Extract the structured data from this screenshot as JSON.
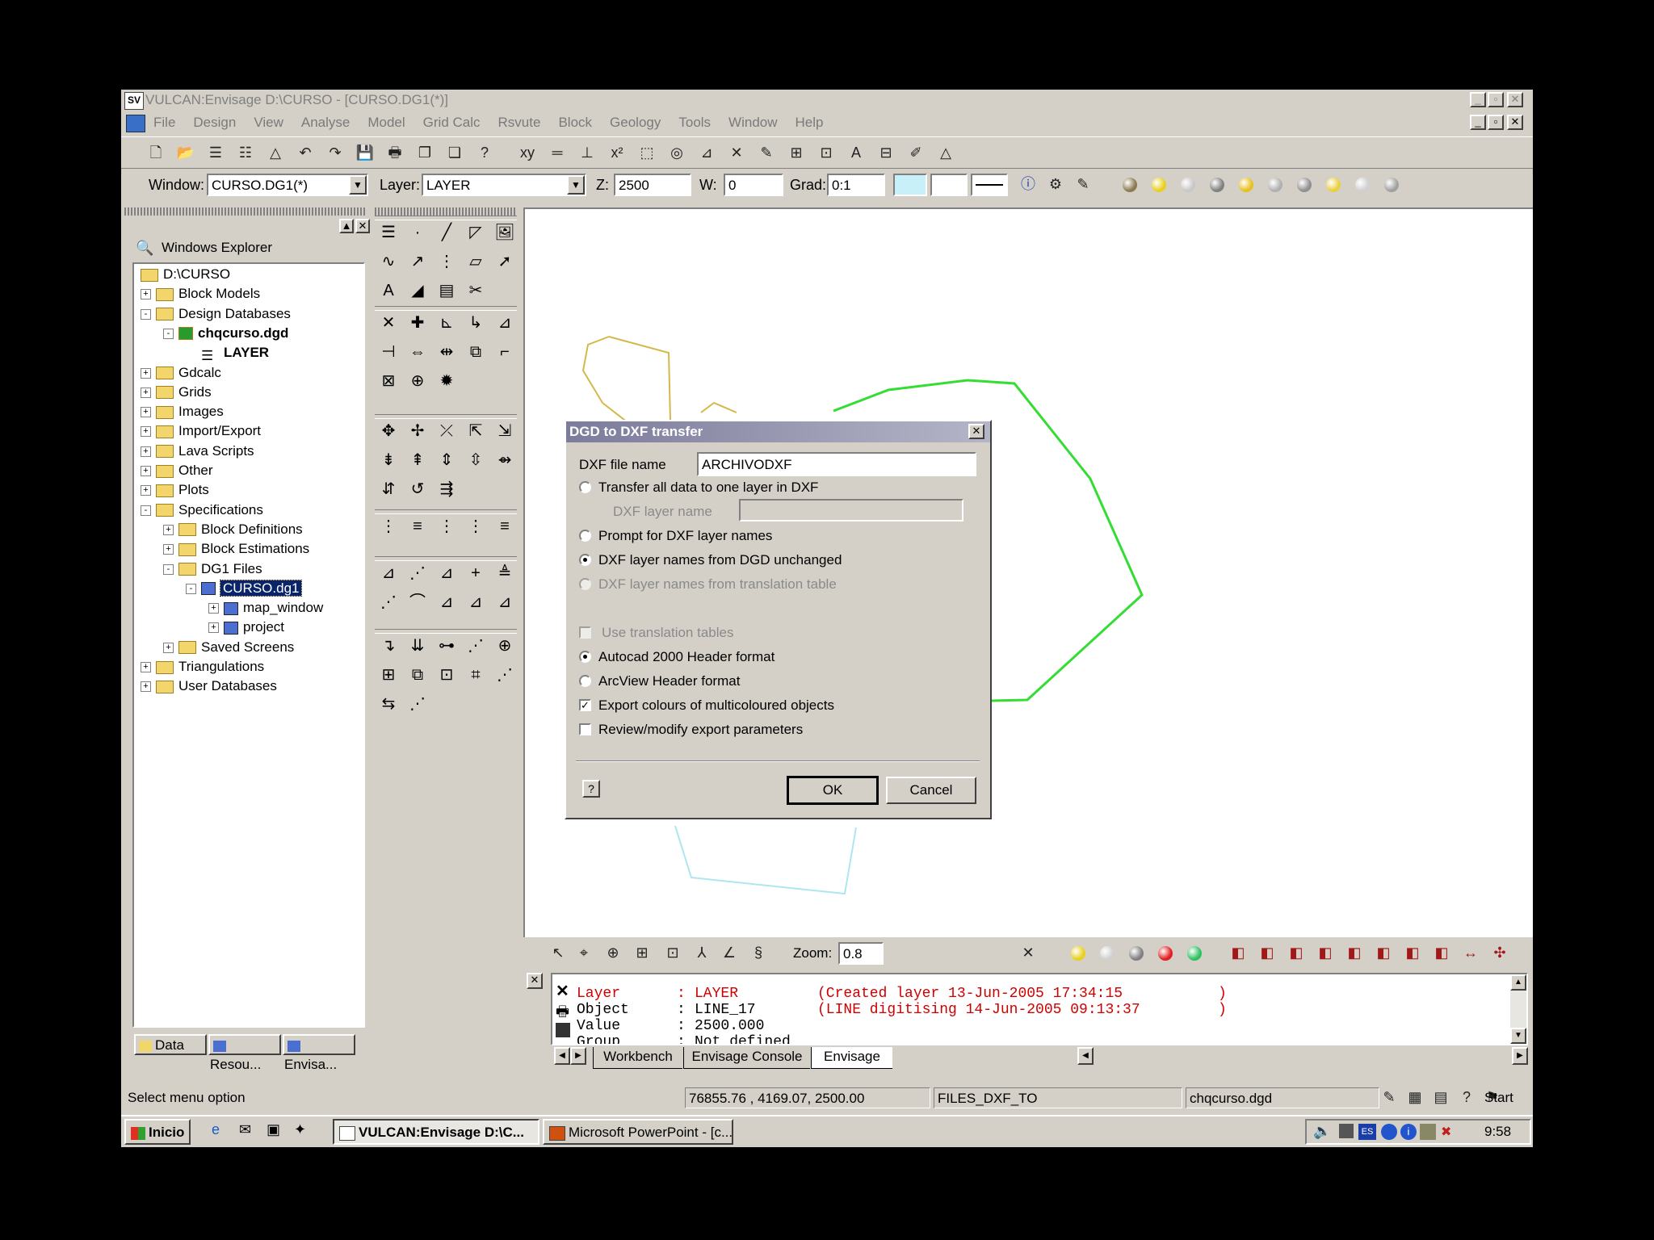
{
  "window": {
    "title": "VULCAN:Envisage  D:\\CURSO - [CURSO.DG1(*)]",
    "app_icon": "SV"
  },
  "menu": [
    "File",
    "Design",
    "View",
    "Analyse",
    "Model",
    "Grid Calc",
    "Rsvute",
    "Block",
    "Geology",
    "Tools",
    "Window",
    "Help"
  ],
  "toolbar": {
    "window_label": "Window:",
    "window_value": "CURSO.DG1(*)",
    "layer_label": "Layer:",
    "layer_value": "LAYER",
    "z_label": "Z:",
    "z_value": "2500",
    "w_label": "W:",
    "w_value": "0",
    "grad_label": "Grad:",
    "grad_value": "0:1"
  },
  "explorer": {
    "title": "Windows Explorer",
    "items": [
      {
        "label": "D:\\CURSO"
      },
      {
        "label": "Block Models"
      },
      {
        "label": "Design Databases"
      },
      {
        "label": "chqcurso.dgd"
      },
      {
        "label": "LAYER"
      },
      {
        "label": "Gdcalc"
      },
      {
        "label": "Grids"
      },
      {
        "label": "Images"
      },
      {
        "label": "Import/Export"
      },
      {
        "label": "Lava Scripts"
      },
      {
        "label": "Other"
      },
      {
        "label": "Plots"
      },
      {
        "label": "Specifications"
      },
      {
        "label": "Block Definitions"
      },
      {
        "label": "Block Estimations"
      },
      {
        "label": "DG1 Files"
      },
      {
        "label": "CURSO.dg1"
      },
      {
        "label": "map_window"
      },
      {
        "label": "project"
      },
      {
        "label": "Saved Screens"
      },
      {
        "label": "Triangulations"
      },
      {
        "label": "User Databases"
      }
    ],
    "tabs": [
      "Data",
      "Resou...",
      "Envisa..."
    ]
  },
  "dialog": {
    "title": "DGD to DXF transfer",
    "file_label": "DXF file name",
    "file_value": "ARCHIVODXF",
    "opt_all_one_layer": "Transfer all data to one layer in DXF",
    "dxf_layer_label": "DXF layer name",
    "opt_prompt": "Prompt for DXF layer names",
    "opt_unchanged": "DXF layer names from DGD unchanged",
    "opt_translation": "DXF layer names from translation table",
    "chk_use_translation": "Use translation tables",
    "opt_autocad": "Autocad 2000 Header format",
    "opt_arcview": "ArcView Header format",
    "chk_export_colours": "Export colours of multicoloured objects",
    "chk_review": "Review/modify export parameters",
    "ok": "OK",
    "cancel": "Cancel"
  },
  "bottom_toolbar": {
    "zoom_label": "Zoom:",
    "zoom_value": "0.8"
  },
  "console": {
    "lines": [
      {
        "key": "Layer",
        "sep": ":",
        "val": "LAYER",
        "note": "(Created layer 13-Jun-2005 17:34:15",
        "end": ")"
      },
      {
        "key": "Object",
        "sep": ":",
        "val": "LINE_17",
        "note": "(LINE digitising 14-Jun-2005 09:13:37",
        "end": ")"
      },
      {
        "key": "Value",
        "sep": ":",
        "val": "2500.000"
      },
      {
        "key": "Group",
        "sep": ":",
        "val": "Not defined"
      }
    ],
    "tabs": [
      "Workbench",
      "Envisage Console",
      "Envisage"
    ]
  },
  "statusbar": {
    "message": "Select menu option",
    "coords": "76855.76 , 4169.07, 2500.00",
    "command": "FILES_DXF_TO",
    "file": "chqcurso.dgd",
    "start": "Start"
  },
  "taskbar": {
    "start": "Inicio",
    "tasks": [
      "VULCAN:Envisage  D:\\C...",
      "Microsoft PowerPoint - [c..."
    ],
    "clock": "9:58",
    "lang": "ES"
  },
  "colors": {
    "green": "#33dd33",
    "yellow": "#d4b84a",
    "cyan": "#aee6ee",
    "title_grad": "#7b7b9b"
  }
}
